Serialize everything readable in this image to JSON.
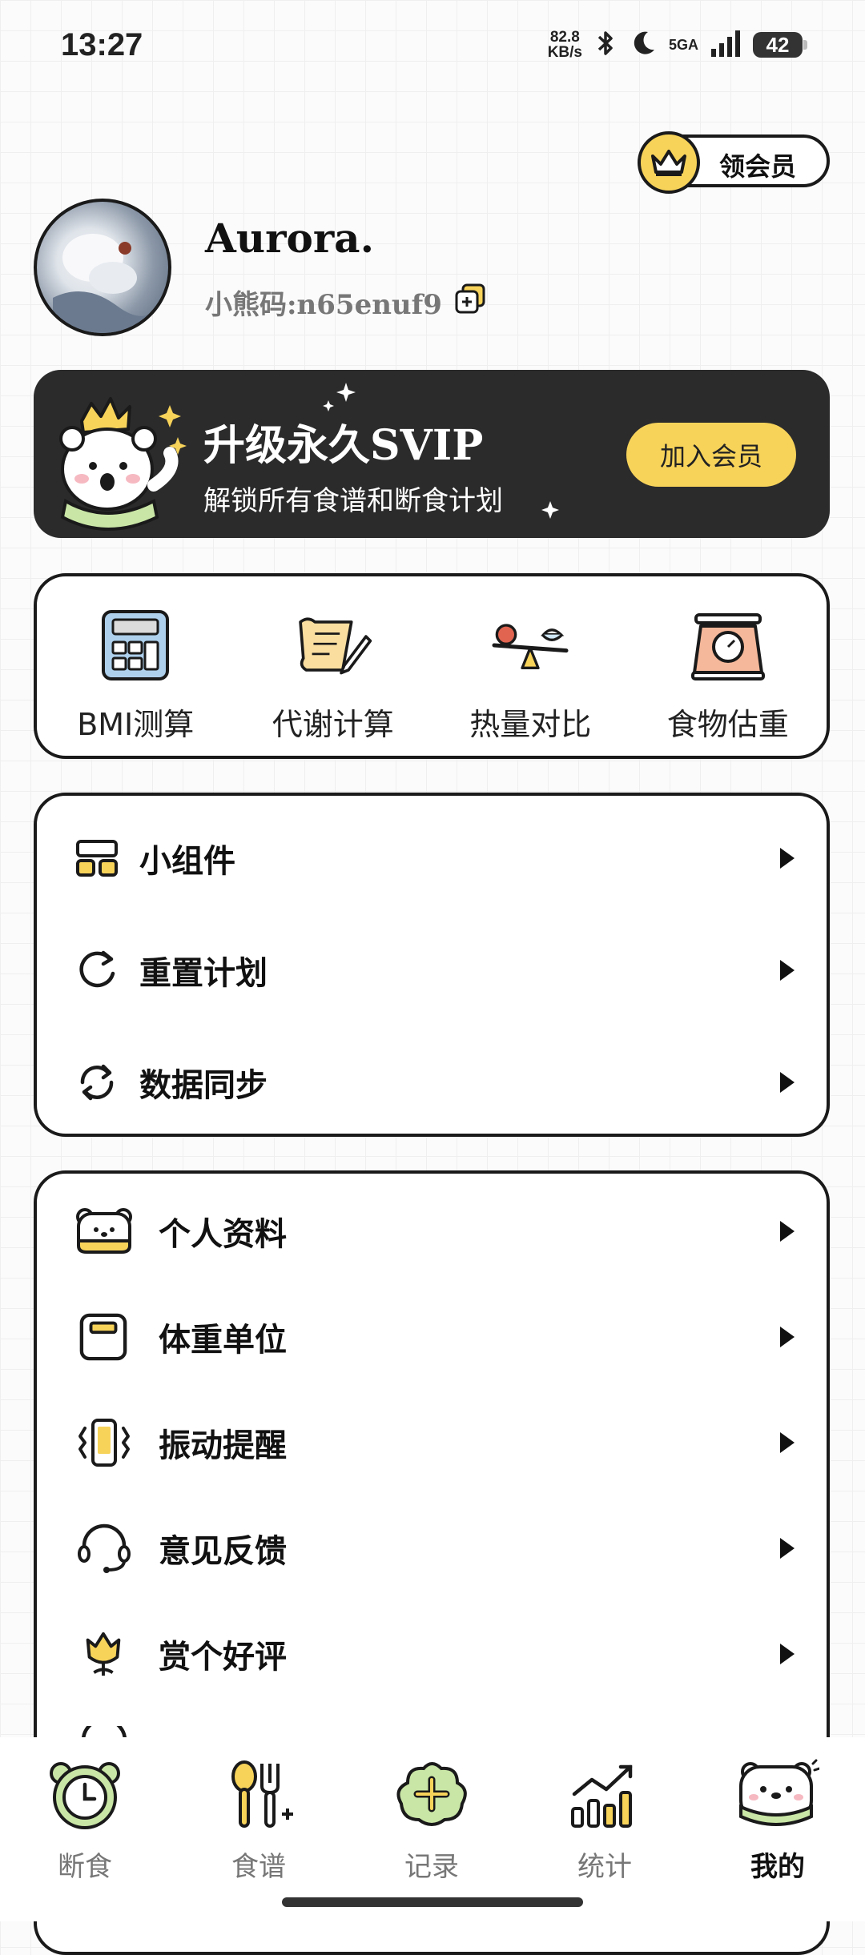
{
  "status_bar": {
    "time": "13:27",
    "speed_value": "82.8",
    "speed_unit": "KB/s",
    "network": "5GA",
    "battery": "42"
  },
  "member_pill": {
    "label": "领会员",
    "icon": "crown-icon"
  },
  "profile": {
    "username": "Aurora.",
    "code": "小熊码:n65enuf9"
  },
  "banner": {
    "title": "升级永久SVIP",
    "subtitle": "解锁所有食谱和断食计划",
    "button": "加入会员",
    "accent": "#f7d35a",
    "background": "#2b2b2b"
  },
  "tools": [
    {
      "label": "BMI测算",
      "icon": "calculator-icon"
    },
    {
      "label": "代谢计算",
      "icon": "scroll-pen-icon"
    },
    {
      "label": "热量对比",
      "icon": "balance-scale-icon"
    },
    {
      "label": "食物估重",
      "icon": "kitchen-scale-icon"
    }
  ],
  "menu_group_1": [
    {
      "label": "小组件",
      "icon": "widget-icon"
    },
    {
      "label": "重置计划",
      "icon": "reset-icon"
    },
    {
      "label": "数据同步",
      "icon": "sync-icon"
    }
  ],
  "menu_group_2": [
    {
      "label": "个人资料",
      "icon": "bear-profile-icon"
    },
    {
      "label": "体重单位",
      "icon": "weight-unit-icon"
    },
    {
      "label": "振动提醒",
      "icon": "vibrate-icon"
    },
    {
      "label": "意见反馈",
      "icon": "headset-icon"
    },
    {
      "label": "赏个好评",
      "icon": "flower-icon"
    }
  ],
  "tabbar": [
    {
      "label": "断食",
      "icon": "clock-bear-icon",
      "active": false
    },
    {
      "label": "食谱",
      "icon": "spoon-fork-icon",
      "active": false
    },
    {
      "label": "记录",
      "icon": "plus-cloud-icon",
      "active": false
    },
    {
      "label": "统计",
      "icon": "chart-icon",
      "active": false
    },
    {
      "label": "我的",
      "icon": "bear-face-icon",
      "active": true
    }
  ]
}
